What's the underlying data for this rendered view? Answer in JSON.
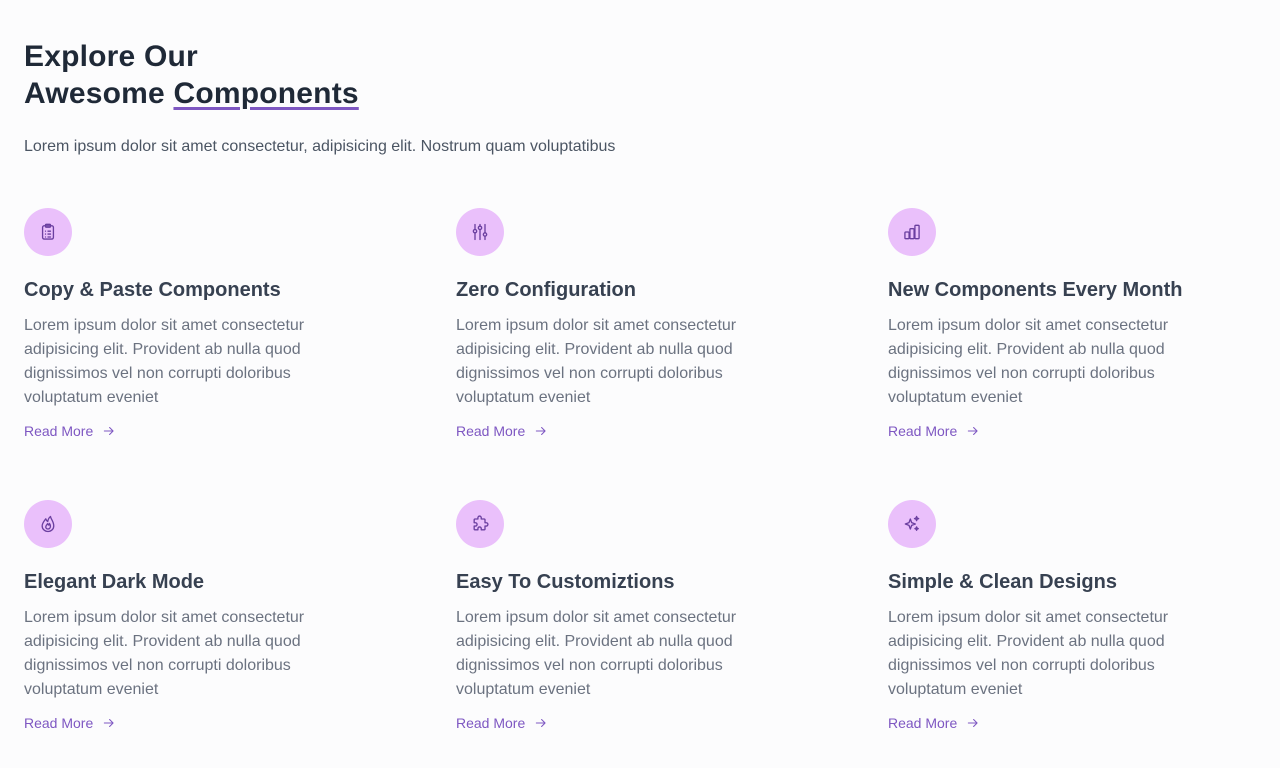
{
  "header": {
    "title_line1": "Explore Our",
    "title_line2_prefix": "Awesome ",
    "title_highlight": "Components",
    "intro": "Lorem ipsum dolor sit amet consectetur, adipisicing elit. Nostrum quam voluptatibus"
  },
  "colors": {
    "accent": "#7e57c2",
    "icon_bg": "#eac0fb",
    "icon_fg": "#6b3fa0",
    "title": "#374151",
    "text": "#6b7280"
  },
  "features": [
    {
      "icon": "clipboard-icon",
      "title": "Copy & Paste Components",
      "text": "Lorem ipsum dolor sit amet consectetur adipisicing elit. Provident ab nulla quod dignissimos vel non corrupti doloribus voluptatum eveniet",
      "link": "Read More"
    },
    {
      "icon": "sliders-icon",
      "title": "Zero Configuration",
      "text": "Lorem ipsum dolor sit amet consectetur adipisicing elit. Provident ab nulla quod dignissimos vel non corrupti doloribus voluptatum eveniet",
      "link": "Read More"
    },
    {
      "icon": "bar-chart-icon",
      "title": "New Components Every Month",
      "text": "Lorem ipsum dolor sit amet consectetur adipisicing elit. Provident ab nulla quod dignissimos vel non corrupti doloribus voluptatum eveniet",
      "link": "Read More"
    },
    {
      "icon": "flame-icon",
      "title": "Elegant Dark Mode",
      "text": "Lorem ipsum dolor sit amet consectetur adipisicing elit. Provident ab nulla quod dignissimos vel non corrupti doloribus voluptatum eveniet",
      "link": "Read More"
    },
    {
      "icon": "puzzle-icon",
      "title": "Easy To Customiztions",
      "text": "Lorem ipsum dolor sit amet consectetur adipisicing elit. Provident ab nulla quod dignissimos vel non corrupti doloribus voluptatum eveniet",
      "link": "Read More"
    },
    {
      "icon": "sparkles-icon",
      "title": "Simple & Clean Designs",
      "text": "Lorem ipsum dolor sit amet consectetur adipisicing elit. Provident ab nulla quod dignissimos vel non corrupti doloribus voluptatum eveniet",
      "link": "Read More"
    }
  ]
}
